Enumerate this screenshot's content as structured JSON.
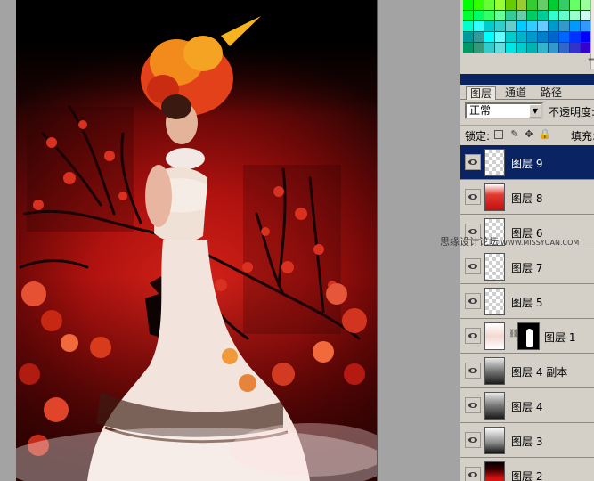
{
  "palette": {
    "swatches": [
      "#00ff00",
      "#33ff00",
      "#66ff33",
      "#99ff33",
      "#66cc00",
      "#99cc33",
      "#33cc33",
      "#66cc66",
      "#00cc33",
      "#33cc66",
      "#66ff66",
      "#99ff99",
      "#00ff33",
      "#00ff66",
      "#33ff66",
      "#66ff99",
      "#33cc99",
      "#66ccaa",
      "#00cc66",
      "#00cc99",
      "#33ffcc",
      "#66ffcc",
      "#99ffcc",
      "#ccffee",
      "#00ffcc",
      "#33ffff",
      "#00cccc",
      "#33cccc",
      "#66cccc",
      "#00ccff",
      "#33ccff",
      "#66ccff",
      "#0099cc",
      "#3399cc",
      "#0099ff",
      "#3399ff",
      "#009999",
      "#339999",
      "#00ffff",
      "#66ffff",
      "#00cccc",
      "#00b3cc",
      "#0099cc",
      "#0080cc",
      "#0066cc",
      "#0066ff",
      "#0033ff",
      "#0000ff",
      "#009966",
      "#33997a",
      "#33cccc",
      "#66dddd",
      "#00e6e6",
      "#00cccc",
      "#00b3b3",
      "#33b3cc",
      "#3399cc",
      "#3366cc",
      "#3333cc",
      "#3300cc"
    ],
    "scroll_label": "="
  },
  "layers_panel": {
    "tabs": [
      {
        "label": "图层",
        "active": true
      },
      {
        "label": "通道",
        "active": false
      },
      {
        "label": "路径",
        "active": false
      }
    ],
    "blend_mode": "正常",
    "opacity_label": "不透明度:",
    "lock_label": "锁定:",
    "fill_label": "填充:",
    "layers": [
      {
        "name": "图层 9",
        "thumb": "checker",
        "selected": true
      },
      {
        "name": "图层 8",
        "thumb": "red",
        "selected": false
      },
      {
        "name": "图层 6",
        "thumb": "checker",
        "selected": false
      },
      {
        "name": "图层 7",
        "thumb": "checker",
        "selected": false
      },
      {
        "name": "图层 5",
        "thumb": "checker",
        "selected": false
      },
      {
        "name": "图层 1",
        "thumb": "girl",
        "selected": false,
        "mask": true
      },
      {
        "name": "图层 4 副本",
        "thumb": "dark",
        "selected": false
      },
      {
        "name": "图层 4",
        "thumb": "dark",
        "selected": false
      },
      {
        "name": "图层 3",
        "thumb": "grad",
        "selected": false
      },
      {
        "name": "图层 2",
        "thumb": "darkred",
        "selected": false
      }
    ]
  },
  "watermark": {
    "text": "思缘设计论坛",
    "url": "WWW.MISSYUAN.COM"
  },
  "colors": {
    "selection": "#0a2463",
    "panel_bg": "#d4d0c8",
    "workspace_bg": "#a3a3a3"
  }
}
